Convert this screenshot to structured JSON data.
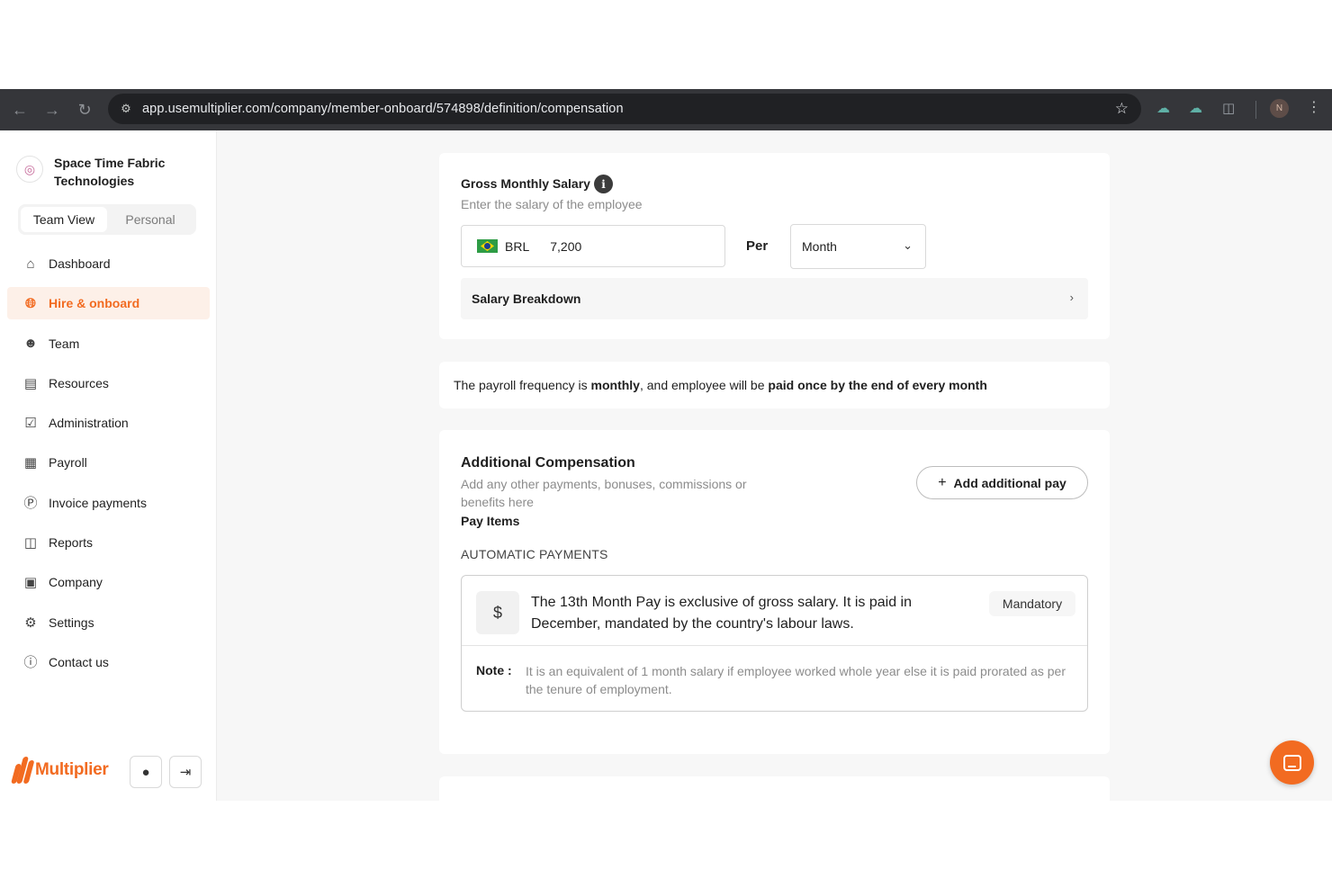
{
  "browser": {
    "url": "app.usemultiplier.com/company/member-onboard/574898/definition/compensation",
    "profile_initial": "N"
  },
  "sidebar": {
    "org_name": "Space Time Fabric Technologies",
    "views": [
      {
        "label": "Team View",
        "active": true
      },
      {
        "label": "Personal",
        "active": false
      }
    ],
    "items": [
      {
        "label": "Dashboard",
        "icon": "home-icon"
      },
      {
        "label": "Hire & onboard",
        "icon": "globe-icon",
        "active": true
      },
      {
        "label": "Team",
        "icon": "team-icon"
      },
      {
        "label": "Resources",
        "icon": "resources-icon"
      },
      {
        "label": "Administration",
        "icon": "clipboard-check-icon"
      },
      {
        "label": "Payroll",
        "icon": "calendar-icon"
      },
      {
        "label": "Invoice payments",
        "icon": "dollar-circle-icon"
      },
      {
        "label": "Reports",
        "icon": "chart-icon"
      },
      {
        "label": "Company",
        "icon": "building-icon"
      },
      {
        "label": "Settings",
        "icon": "gear-icon"
      },
      {
        "label": "Contact us",
        "icon": "help-icon"
      }
    ],
    "brand": "Multiplier"
  },
  "salary": {
    "title": "Gross Monthly Salary",
    "subtitle": "Enter the salary of the employee",
    "currency": "BRL",
    "amount": "7,200",
    "per_label": "Per",
    "period": "Month",
    "breakdown_label": "Salary Breakdown"
  },
  "payroll_note": {
    "prefix": "The payroll frequency is ",
    "frequency": "monthly",
    "middle": ", and employee will be ",
    "schedule": "paid once by the end of every month"
  },
  "additional": {
    "title": "Additional Compensation",
    "subtitle": "Add any other payments, bonuses, commissions or benefits here",
    "add_button": "Add additional pay",
    "pay_items_label": "Pay Items",
    "automatic_label": "AUTOMATIC PAYMENTS",
    "item": {
      "symbol": "$",
      "description": "The 13th Month Pay is exclusive of gross salary. It is paid in December, mandated by the country's labour laws.",
      "badge": "Mandatory",
      "note_label": "Note :",
      "note": "It is an equivalent of 1 month salary if employee worked whole year else it is paid prorated as per the tenure of employment."
    }
  },
  "colors": {
    "accent": "#f26b21",
    "browser_bar": "#35363a"
  }
}
